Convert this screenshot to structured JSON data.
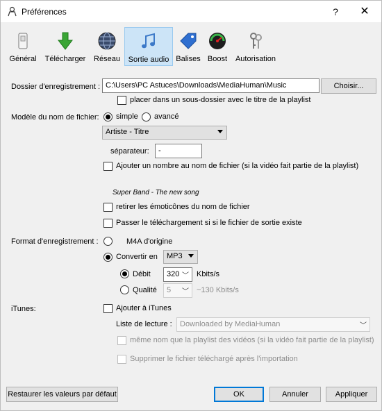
{
  "window": {
    "title": "Préférences",
    "help": "?",
    "close": "✕"
  },
  "toolbar": {
    "items": [
      {
        "label": "Général",
        "icon": "general-icon"
      },
      {
        "label": "Télécharger",
        "icon": "download-arrow-icon"
      },
      {
        "label": "Réseau",
        "icon": "globe-icon"
      },
      {
        "label": "Sortie audio",
        "icon": "music-note-icon",
        "selected": true
      },
      {
        "label": "Balises",
        "icon": "tag-icon"
      },
      {
        "label": "Boost",
        "icon": "speedometer-icon"
      },
      {
        "label": "Autorisation",
        "icon": "keys-icon"
      }
    ]
  },
  "folder": {
    "label": "Dossier d'enregistrement :",
    "path": "C:\\Users\\PC Astuces\\Downloads\\MediaHuman\\Music",
    "choose": "Choisir...",
    "subfolder": "placer dans un sous-dossier avec le titre de la playlist"
  },
  "filename": {
    "label": "Modèle du nom de fichier:",
    "simple": "simple",
    "advanced": "avancé",
    "pattern": "Artiste - Titre",
    "separator_label": "séparateur:",
    "separator_value": "-",
    "add_number": "Ajouter un nombre au nom de fichier (si la vidéo fait partie de la playlist)",
    "preview": "Super Band - The new song",
    "remove_emoticons": "retirer les émoticônes du nom de fichier",
    "skip_existing": "Passer le téléchargement si si le fichier de sortie existe"
  },
  "format": {
    "label": "Format d'enregistrement :",
    "original": "M4A d'origine",
    "convert": "Convertir en",
    "codec": "MP3",
    "bitrate_label": "Débit",
    "bitrate": "320",
    "bitrate_unit": "Kbits/s",
    "quality_label": "Qualité",
    "quality": "5",
    "quality_hint": "~130 Kbits/s"
  },
  "itunes": {
    "label": "iTunes:",
    "add": "Ajouter à iTunes",
    "playlist_label": "Liste de lecture :",
    "playlist": "Downloaded by MediaHuman",
    "same_name": "même nom que la playlist des vidéos (si la vidéo fait partie de la playlist)",
    "delete_after": "Supprimer le fichier téléchargé après l'importation"
  },
  "footer": {
    "restore": "Restaurer les valeurs par défaut",
    "ok": "OK",
    "cancel": "Annuler",
    "apply": "Appliquer"
  }
}
